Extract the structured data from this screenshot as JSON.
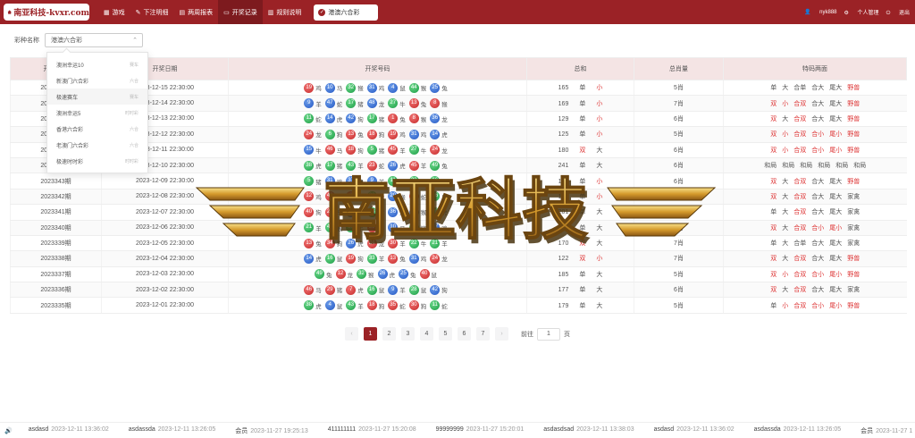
{
  "brand": {
    "name": "南亚科技-kvxr.com"
  },
  "nav": [
    {
      "icon": "grid-icon",
      "label": "游戏",
      "active": false
    },
    {
      "icon": "edit-icon",
      "label": "下注明细",
      "active": false
    },
    {
      "icon": "calendar-icon",
      "label": "两周报表",
      "active": false
    },
    {
      "icon": "monitor-icon",
      "label": "开奖记录",
      "active": true
    },
    {
      "icon": "doc-icon",
      "label": "规则说明",
      "active": false
    }
  ],
  "current_lottery": "港澳六合彩",
  "user": {
    "name": "nyk888",
    "profile": "个人管理",
    "logout": "退出"
  },
  "filter": {
    "label": "彩种名称",
    "value": "港澳六合彩"
  },
  "dropdown": [
    {
      "name": "澳洲幸运10",
      "tag": "赛车"
    },
    {
      "name": "新澳门六合彩",
      "tag": "六合"
    },
    {
      "name": "极速赛车",
      "tag": "赛车"
    },
    {
      "name": "澳洲幸运5",
      "tag": "时时彩"
    },
    {
      "name": "香港六合彩",
      "tag": "六合"
    },
    {
      "name": "老澳门六合彩",
      "tag": "六合"
    },
    {
      "name": "极速时时彩",
      "tag": "时时彩"
    }
  ],
  "table": {
    "headers": [
      "开奖期号",
      "开奖日期",
      "开奖号码",
      "总和",
      "总肖量",
      "特码两面"
    ],
    "rows": [
      {
        "issue": "2023349期",
        "date": "2023-12-15 22:30:00",
        "balls": [
          [
            19,
            "red",
            "鸡"
          ],
          [
            10,
            "blue",
            "马"
          ],
          [
            32,
            "green",
            "猴"
          ],
          [
            31,
            "blue",
            "鸡"
          ],
          [
            4,
            "blue",
            "鼠"
          ],
          [
            44,
            "green",
            "猴"
          ],
          [
            25,
            "blue",
            "兔"
          ]
        ],
        "sum": "165",
        "s1": "单",
        "s2": "小",
        "xiao": "5肖",
        "feat": [
          "单",
          "大",
          "合单",
          "合大",
          "尾大",
          "野兽"
        ]
      },
      {
        "issue": "2023348期",
        "date": "2023-12-14 22:30:00",
        "balls": [
          [
            9,
            "blue",
            "羊"
          ],
          [
            47,
            "blue",
            "蛇"
          ],
          [
            17,
            "green",
            "猪"
          ],
          [
            48,
            "blue",
            "龙"
          ],
          [
            27,
            "green",
            "牛"
          ],
          [
            13,
            "red",
            "兔"
          ],
          [
            8,
            "red",
            "猴"
          ]
        ],
        "sum": "169",
        "s1": "单",
        "s2": "小",
        "xiao": "7肖",
        "feat": [
          "双",
          "小",
          "合双",
          "合大",
          "尾大",
          "野兽"
        ]
      },
      {
        "issue": "2023347期",
        "date": "2023-12-13 22:30:00",
        "balls": [
          [
            11,
            "green",
            "蛇"
          ],
          [
            14,
            "blue",
            "虎"
          ],
          [
            42,
            "blue",
            "狗"
          ],
          [
            17,
            "green",
            "猪"
          ],
          [
            1,
            "red",
            "兔"
          ],
          [
            8,
            "red",
            "猴"
          ],
          [
            36,
            "blue",
            "龙"
          ]
        ],
        "sum": "129",
        "s1": "单",
        "s2": "小",
        "xiao": "6肖",
        "feat": [
          "双",
          "大",
          "合双",
          "合大",
          "尾大",
          "野兽"
        ]
      },
      {
        "issue": "2023346期",
        "date": "2023-12-12 22:30:00",
        "balls": [
          [
            24,
            "red",
            "龙"
          ],
          [
            6,
            "green",
            "狗"
          ],
          [
            13,
            "red",
            "兔"
          ],
          [
            18,
            "red",
            "狗"
          ],
          [
            19,
            "red",
            "鸡"
          ],
          [
            31,
            "blue",
            "鸡"
          ],
          [
            14,
            "blue",
            "虎"
          ]
        ],
        "sum": "125",
        "s1": "单",
        "s2": "小",
        "xiao": "5肖",
        "feat": [
          "双",
          "小",
          "合双",
          "合小",
          "尾小",
          "野兽"
        ]
      },
      {
        "issue": "2023345期",
        "date": "2023-12-11 22:30:00",
        "balls": [
          [
            15,
            "blue",
            "牛"
          ],
          [
            46,
            "red",
            "马"
          ],
          [
            18,
            "red",
            "狗"
          ],
          [
            5,
            "green",
            "猪"
          ],
          [
            45,
            "red",
            "羊"
          ],
          [
            27,
            "green",
            "牛"
          ],
          [
            24,
            "red",
            "龙"
          ]
        ],
        "sum": "180",
        "s1": "双",
        "s2": "大",
        "xiao": "6肖",
        "feat": [
          "双",
          "小",
          "合双",
          "合小",
          "尾小",
          "野兽"
        ]
      },
      {
        "issue": "2023344期",
        "date": "2023-12-10 22:30:00",
        "balls": [
          [
            38,
            "green",
            "虎"
          ],
          [
            17,
            "green",
            "猪"
          ],
          [
            43,
            "green",
            "羊"
          ],
          [
            23,
            "red",
            "蛇"
          ],
          [
            26,
            "blue",
            "虎"
          ],
          [
            45,
            "red",
            "羊"
          ],
          [
            49,
            "green",
            "兔"
          ]
        ],
        "sum": "241",
        "s1": "单",
        "s2": "大",
        "xiao": "6肖",
        "feat": [
          "和局",
          "和局",
          "和局",
          "和局",
          "和局",
          "和局"
        ]
      },
      {
        "issue": "2023343期",
        "date": "2023-12-09 22:30:00",
        "balls": [
          [
            5,
            "green",
            "猪"
          ],
          [
            31,
            "blue",
            "鸡"
          ],
          [
            37,
            "blue",
            "鸡"
          ],
          [
            9,
            "blue",
            "羊"
          ],
          [
            11,
            "green",
            "蛇"
          ],
          [
            22,
            "green",
            "猴"
          ],
          [
            16,
            "green",
            "鼠"
          ]
        ],
        "sum": "131",
        "s1": "单",
        "s2": "小",
        "xiao": "6肖",
        "feat": [
          "双",
          "大",
          "合双",
          "合大",
          "尾大",
          "野兽"
        ]
      },
      {
        "issue": "2023342期",
        "date": "2023-12-08 22:30:00",
        "balls": [
          [
            12,
            "red",
            "鸡"
          ],
          [
            40,
            "red",
            "狗"
          ],
          [
            2,
            "red",
            "狗"
          ],
          [
            38,
            "green",
            "虎"
          ],
          [
            20,
            "blue",
            "猴"
          ],
          [
            23,
            "red",
            "蛇"
          ],
          [
            16,
            "green",
            "鼠"
          ]
        ],
        "sum": "151",
        "s1": "单",
        "s2": "小",
        "xiao": "6肖",
        "feat": [
          "双",
          "大",
          "合双",
          "合大",
          "尾大",
          "家禽"
        ]
      },
      {
        "issue": "2023341期",
        "date": "2023-12-07 22:30:00",
        "balls": [
          [
            40,
            "red",
            "狗"
          ],
          [
            29,
            "red",
            "马"
          ],
          [
            15,
            "blue",
            "牛"
          ],
          [
            33,
            "green",
            "猪"
          ],
          [
            36,
            "blue",
            "龙"
          ],
          [
            20,
            "blue",
            "猴"
          ],
          [
            28,
            "green",
            "虎"
          ]
        ],
        "sum": "201",
        "s1": "单",
        "s2": "大",
        "xiao": "7肖",
        "feat": [
          "单",
          "大",
          "合双",
          "合大",
          "尾大",
          "家禽"
        ]
      },
      {
        "issue": "2023340期",
        "date": "2023-12-06 22:30:00",
        "balls": [
          [
            21,
            "green",
            "羊"
          ],
          [
            44,
            "green",
            "猴"
          ],
          [
            39,
            "green",
            "牛"
          ],
          [
            29,
            "red",
            "马"
          ],
          [
            10,
            "blue",
            "马"
          ],
          [
            17,
            "green",
            "猪"
          ],
          [
            37,
            "blue",
            "鸡"
          ]
        ],
        "sum": "197",
        "s1": "单",
        "s2": "大",
        "xiao": "6肖",
        "feat": [
          "双",
          "大",
          "合双",
          "合小",
          "尾小",
          "家禽"
        ]
      },
      {
        "issue": "2023339期",
        "date": "2023-12-05 22:30:00",
        "balls": [
          [
            13,
            "red",
            "兔"
          ],
          [
            34,
            "red",
            "狗"
          ],
          [
            26,
            "blue",
            "虎"
          ],
          [
            24,
            "red",
            "龙"
          ],
          [
            30,
            "red",
            "羊"
          ],
          [
            22,
            "green",
            "牛"
          ],
          [
            21,
            "green",
            "羊"
          ]
        ],
        "sum": "170",
        "s1": "双",
        "s2": "大",
        "xiao": "7肖",
        "feat": [
          "单",
          "大",
          "合单",
          "合大",
          "尾大",
          "家禽"
        ]
      },
      {
        "issue": "2023338期",
        "date": "2023-12-04 22:30:00",
        "balls": [
          [
            14,
            "blue",
            "虎"
          ],
          [
            16,
            "green",
            "鼠"
          ],
          [
            19,
            "red",
            "狗"
          ],
          [
            33,
            "green",
            "羊"
          ],
          [
            13,
            "red",
            "兔"
          ],
          [
            31,
            "blue",
            "鸡"
          ],
          [
            24,
            "red",
            "龙"
          ]
        ],
        "sum": "122",
        "s1": "双",
        "s2": "小",
        "xiao": "7肖",
        "feat": [
          "双",
          "大",
          "合双",
          "合大",
          "尾大",
          "野兽"
        ]
      },
      {
        "issue": "2023337期",
        "date": "2023-12-03 22:30:00",
        "balls": [
          [
            49,
            "green",
            "兔"
          ],
          [
            12,
            "red",
            "龙"
          ],
          [
            32,
            "green",
            "猴"
          ],
          [
            26,
            "blue",
            "虎"
          ],
          [
            25,
            "blue",
            "兔"
          ],
          [
            40,
            "red",
            "鼠"
          ]
        ],
        "sum": "185",
        "s1": "单",
        "s2": "大",
        "xiao": "5肖",
        "feat": [
          "双",
          "小",
          "合双",
          "合小",
          "尾小",
          "野兽"
        ]
      },
      {
        "issue": "2023336期",
        "date": "2023-12-02 22:30:00",
        "balls": [
          [
            46,
            "red",
            "马"
          ],
          [
            29,
            "red",
            "猪"
          ],
          [
            7,
            "red",
            "虎"
          ],
          [
            16,
            "green",
            "鼠"
          ],
          [
            9,
            "blue",
            "羊"
          ],
          [
            28,
            "green",
            "鼠"
          ],
          [
            42,
            "blue",
            "狗"
          ]
        ],
        "sum": "177",
        "s1": "单",
        "s2": "大",
        "xiao": "6肖",
        "feat": [
          "双",
          "大",
          "合双",
          "合大",
          "尾大",
          "家禽"
        ]
      },
      {
        "issue": "2023335期",
        "date": "2023-12-01 22:30:00",
        "balls": [
          [
            38,
            "green",
            "虎"
          ],
          [
            4,
            "blue",
            "鼠"
          ],
          [
            43,
            "green",
            "羊"
          ],
          [
            18,
            "red",
            "狗"
          ],
          [
            35,
            "red",
            "蛇"
          ],
          [
            30,
            "red",
            "狗"
          ],
          [
            11,
            "green",
            "蛇"
          ]
        ],
        "sum": "179",
        "s1": "单",
        "s2": "大",
        "xiao": "5肖",
        "feat": [
          "单",
          "小",
          "合双",
          "合小",
          "尾小",
          "野兽"
        ]
      }
    ]
  },
  "watermark": {
    "text": "南亚科技"
  },
  "pagination": {
    "pages": [
      "1",
      "2",
      "3",
      "4",
      "5",
      "6",
      "7"
    ],
    "current": "1",
    "goto_label": "前往",
    "goto_value": "1",
    "page_unit": "页"
  },
  "ticker": [
    {
      "name": "asdasd",
      "time": "2023-12-11 13:36:02"
    },
    {
      "name": "asdassda",
      "time": "2023-12-11 13:26:05"
    },
    {
      "name": "会员",
      "time": "2023-11-27 19:25:13"
    },
    {
      "name": "411111111",
      "time": "2023-11-27 15:20:08"
    },
    {
      "name": "99999999",
      "time": "2023-11-27 15:20:01"
    },
    {
      "name": "asdasdsad",
      "time": "2023-12-11 13:38:03"
    },
    {
      "name": "asdasd",
      "time": "2023-12-11 13:36:02"
    },
    {
      "name": "asdassda",
      "time": "2023-12-11 13:26:05"
    },
    {
      "name": "会员",
      "time": "2023-11-27 1"
    }
  ],
  "colors": {
    "brand": "#9b2226",
    "red_ball": "#c52a2a",
    "blue_ball": "#2458c4",
    "green_ball": "#199b44"
  }
}
